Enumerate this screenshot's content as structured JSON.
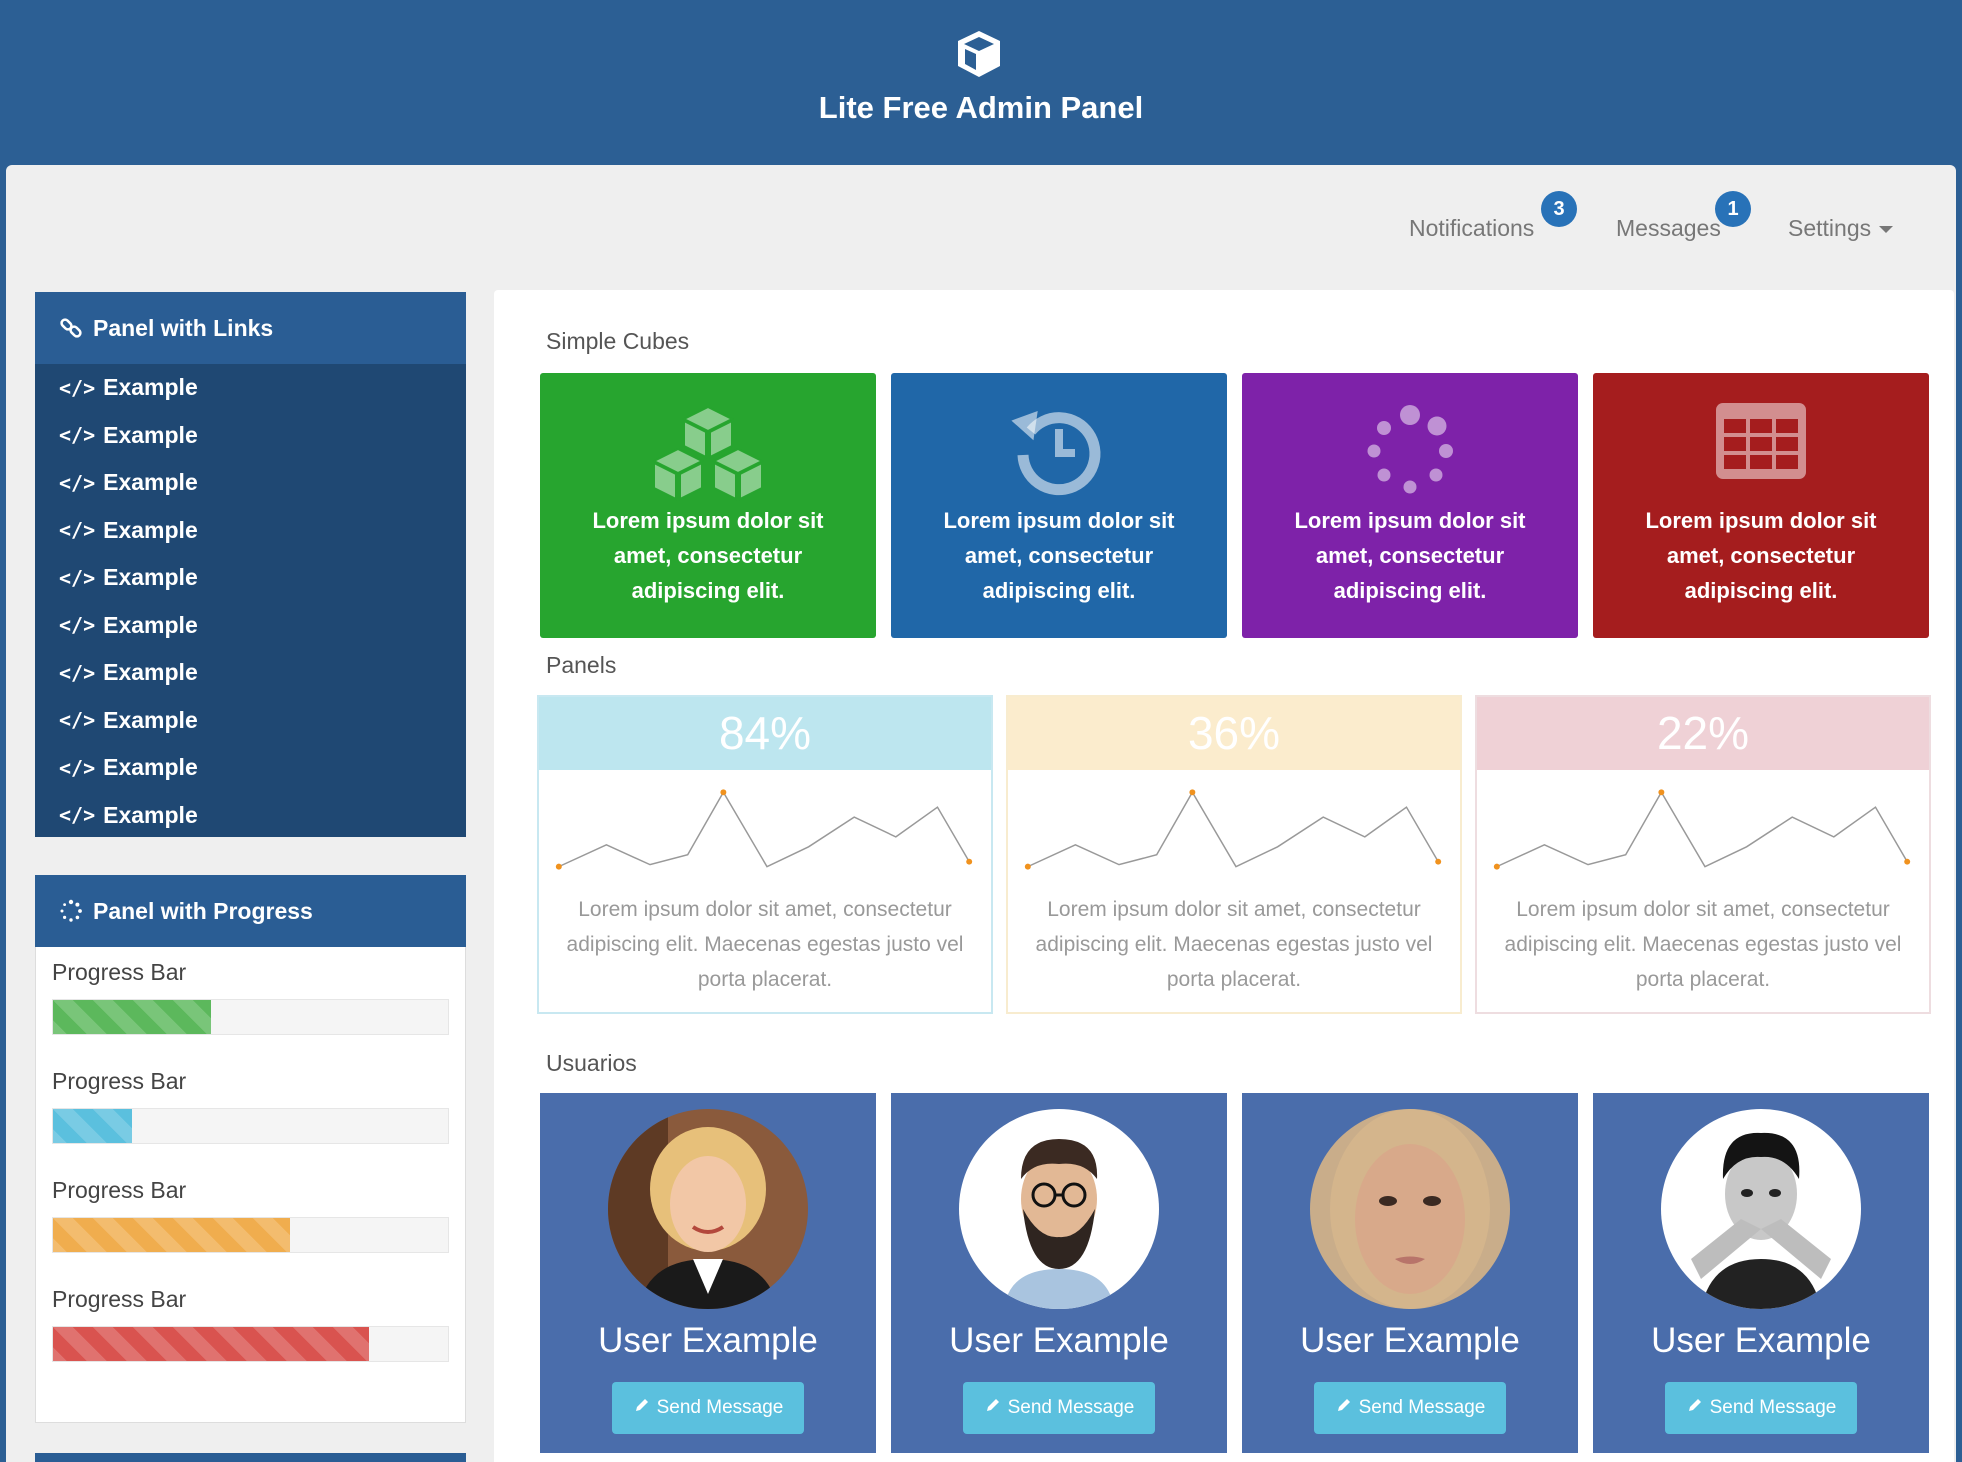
{
  "header": {
    "title": "Lite Free Admin Panel",
    "logo_icon": "cube-icon"
  },
  "topnav": {
    "notifications": {
      "label": "Notifications",
      "count": "3"
    },
    "messages": {
      "label": "Messages",
      "count": "1"
    },
    "settings": {
      "label": "Settings"
    }
  },
  "links_panel": {
    "title": "Panel with Links",
    "icon": "link-icon",
    "items": [
      {
        "label": "Example"
      },
      {
        "label": "Example"
      },
      {
        "label": "Example"
      },
      {
        "label": "Example"
      },
      {
        "label": "Example"
      },
      {
        "label": "Example"
      },
      {
        "label": "Example"
      },
      {
        "label": "Example"
      },
      {
        "label": "Example"
      },
      {
        "label": "Example"
      }
    ],
    "item_icon_glyph": "</>"
  },
  "progress_panel": {
    "title": "Panel with Progress",
    "icon": "spinner-icon",
    "bars": [
      {
        "label": "Progress Bar",
        "value": 0.4,
        "color": "#5cb85c"
      },
      {
        "label": "Progress Bar",
        "value": 0.2,
        "color": "#5bc0de"
      },
      {
        "label": "Progress Bar",
        "value": 0.6,
        "color": "#f0ad4e"
      },
      {
        "label": "Progress Bar",
        "value": 0.8,
        "color": "#d9534f"
      }
    ]
  },
  "cubes_section": {
    "title": "Simple Cubes",
    "cubes": [
      {
        "text": "Lorem ipsum dolor sit amet, consectetur adipiscing elit.",
        "color": "#27a52f",
        "icon": "cubes-icon"
      },
      {
        "text": "Lorem ipsum dolor sit amet, consectetur adipiscing elit.",
        "color": "#2067a8",
        "icon": "history-icon"
      },
      {
        "text": "Lorem ipsum dolor sit amet, consectetur adipiscing elit.",
        "color": "#7e22a9",
        "icon": "spinner-icon"
      },
      {
        "text": "Lorem ipsum dolor sit amet, consectetur adipiscing elit.",
        "color": "#a51d1e",
        "icon": "table-icon"
      }
    ]
  },
  "panels_section": {
    "title": "Panels",
    "panels": [
      {
        "percent": "84%",
        "head_color": "#bde6ef",
        "border_color": "#c8e8f1",
        "text": "Lorem ipsum dolor sit amet, consectetur adipiscing elit. Maecenas egestas justo vel porta placerat."
      },
      {
        "percent": "36%",
        "head_color": "#fbeccd",
        "border_color": "#f8eccf",
        "text": "Lorem ipsum dolor sit amet, consectetur adipiscing elit. Maecenas egestas justo vel porta placerat."
      },
      {
        "percent": "22%",
        "head_color": "#efd1d6",
        "border_color": "#eedde0",
        "text": "Lorem ipsum dolor sit amet, consectetur adipiscing elit. Maecenas egestas justo vel porta placerat."
      }
    ]
  },
  "users_section": {
    "title": "Usuarios",
    "users": [
      {
        "name": "User Example",
        "button": "Send Message",
        "button_icon": "pencil-icon"
      },
      {
        "name": "User Example",
        "button": "Send Message",
        "button_icon": "pencil-icon"
      },
      {
        "name": "User Example",
        "button": "Send Message",
        "button_icon": "pencil-icon"
      },
      {
        "name": "User Example",
        "button": "Send Message",
        "button_icon": "pencil-icon"
      }
    ]
  }
}
